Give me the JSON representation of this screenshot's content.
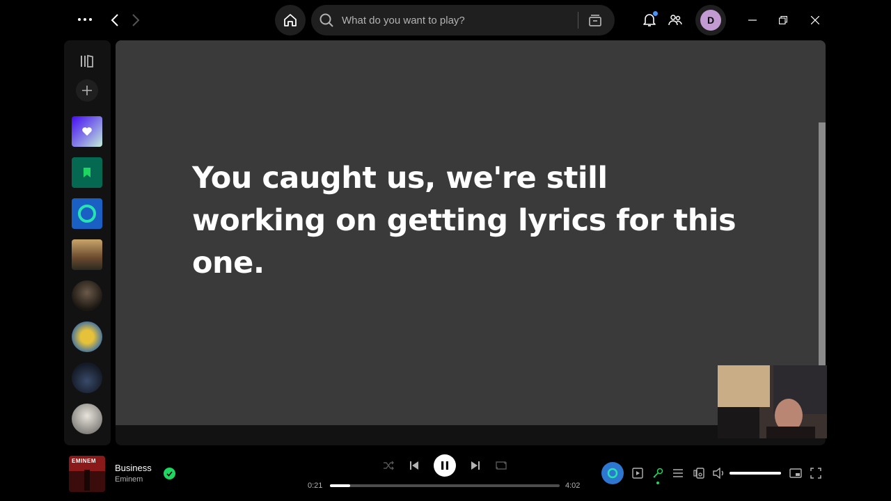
{
  "search": {
    "placeholder": "What do you want to play?"
  },
  "user": {
    "initial": "D"
  },
  "lyrics": {
    "message": "You caught us, we're still working on getting lyrics for this one."
  },
  "now_playing": {
    "title": "Business",
    "artist": "Eminem",
    "cover_text": "EMINEM",
    "time_current": "0:21",
    "time_total": "4:02",
    "progress": 0.087,
    "volume": 1.0
  },
  "colors": {
    "accent_green": "#1ed760",
    "dj_blue": "#2e77d0",
    "avatar": "#c39bd3",
    "notification_dot": "#4d91f2"
  },
  "icons": {
    "menu": "more-dots-icon",
    "back": "chevron-left-icon",
    "forward": "chevron-right-icon",
    "home": "home-icon",
    "search": "search-icon",
    "browse": "browse-icon",
    "notifications": "bell-icon",
    "friends": "friends-icon"
  }
}
